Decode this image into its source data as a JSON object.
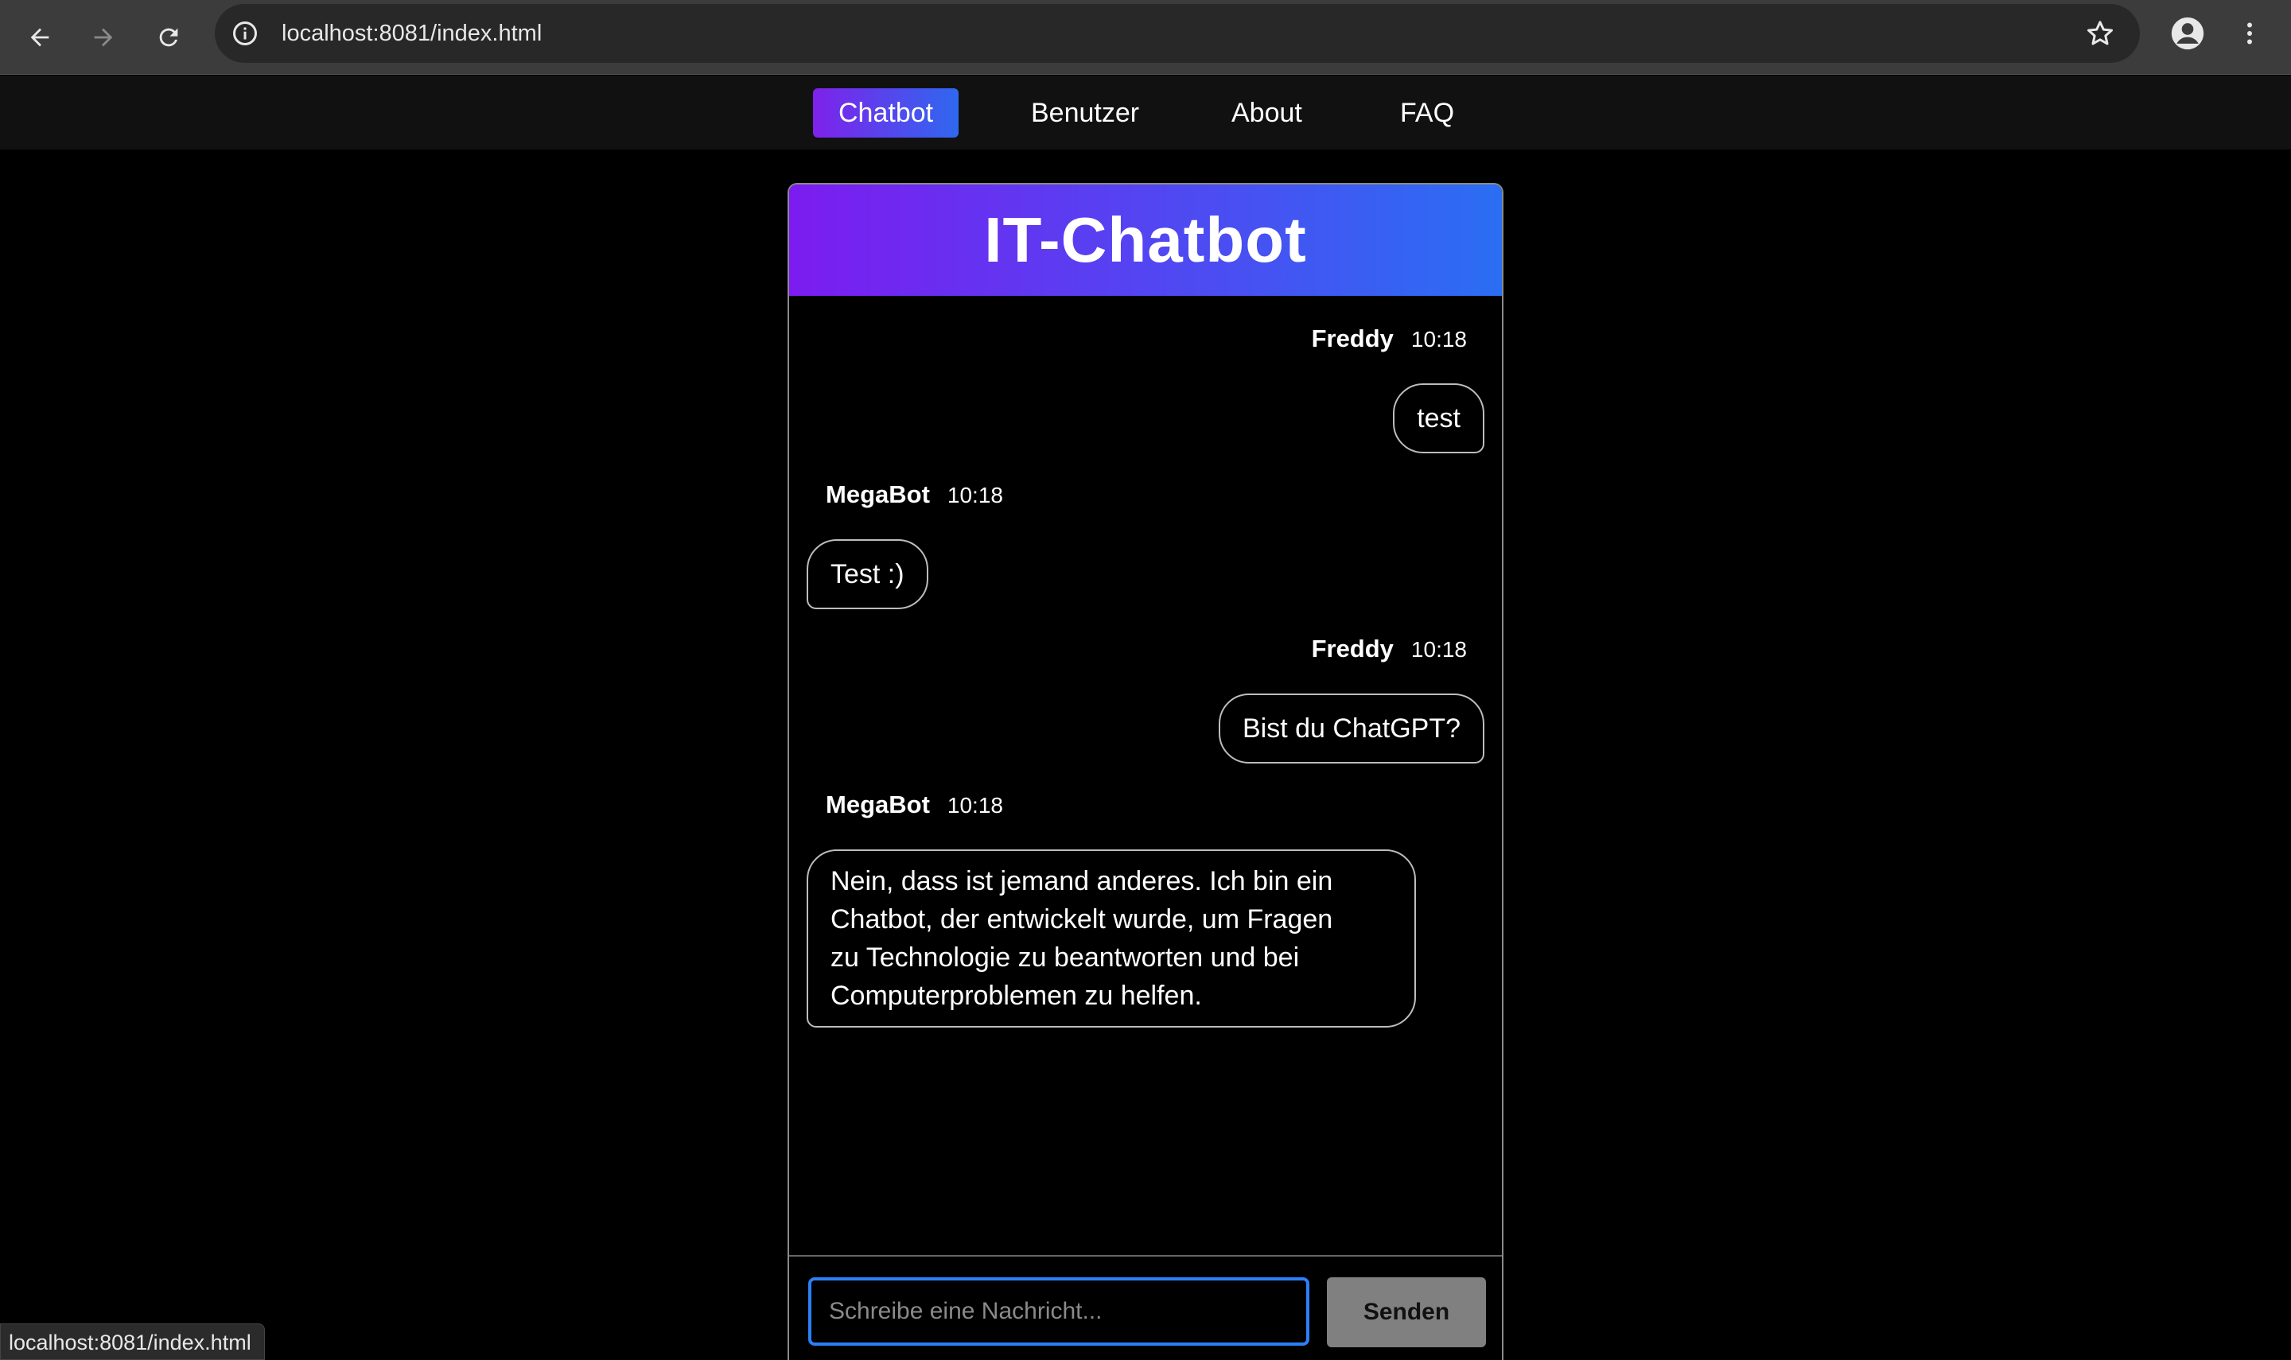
{
  "browser": {
    "url": "localhost:8081/index.html",
    "status_url": "localhost:8081/index.html"
  },
  "nav": {
    "items": [
      {
        "label": "Chatbot",
        "active": true
      },
      {
        "label": "Benutzer",
        "active": false
      },
      {
        "label": "About",
        "active": false
      },
      {
        "label": "FAQ",
        "active": false
      }
    ]
  },
  "chat": {
    "title": "IT-Chatbot",
    "messages": [
      {
        "sender": "Freddy",
        "time": "10:18",
        "text": "test",
        "side": "user"
      },
      {
        "sender": "MegaBot",
        "time": "10:18",
        "text": "Test :)",
        "side": "bot"
      },
      {
        "sender": "Freddy",
        "time": "10:18",
        "text": "Bist du ChatGPT?",
        "side": "user"
      },
      {
        "sender": "MegaBot",
        "time": "10:18",
        "text_lines": [
          "Nein, dass ist jemand anderes. Ich bin ein",
          "Chatbot, der entwickelt wurde, um Fragen",
          "zu Technologie zu beantworten und bei",
          "Computerproblemen zu helfen."
        ],
        "side": "bot"
      }
    ],
    "input_placeholder": "Schreibe eine Nachricht...",
    "input_value": "",
    "send_label": "Senden"
  },
  "colors": {
    "accent_start": "#7c1cf0",
    "accent_end": "#2a6ef3",
    "input_focus": "#2d7ff9",
    "send_button": "#808080"
  },
  "icons": [
    "back-arrow-icon",
    "forward-arrow-icon",
    "reload-icon",
    "info-icon",
    "star-icon",
    "profile-icon",
    "more-menu-icon"
  ]
}
